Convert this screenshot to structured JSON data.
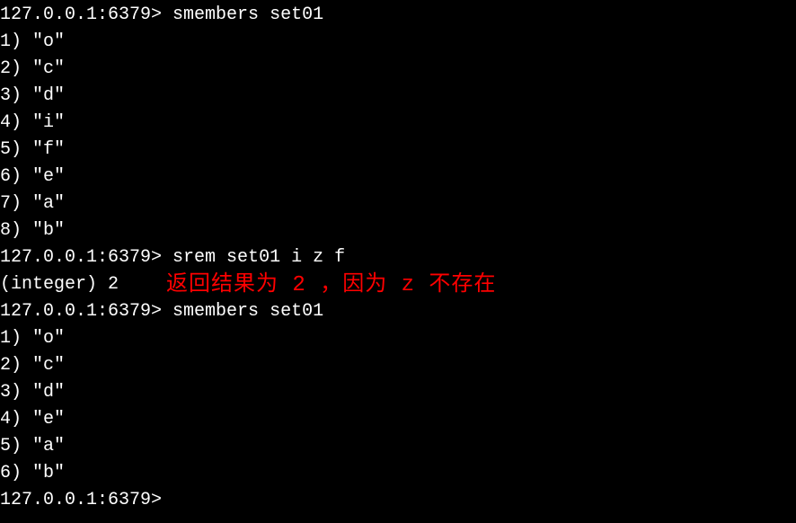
{
  "prompt": "127.0.0.1:6379>",
  "commands": {
    "cmd1": "smembers set01",
    "cmd2": "srem set01 i z f",
    "cmd3": "smembers set01"
  },
  "results1": {
    "r1": "1) \"o\"",
    "r2": "2) \"c\"",
    "r3": "3) \"d\"",
    "r4": "4) \"i\"",
    "r5": "5) \"f\"",
    "r6": "6) \"e\"",
    "r7": "7) \"a\"",
    "r8": "8) \"b\""
  },
  "integer_result": "(integer) 2",
  "annotation": "返回结果为 2 ，因为 z 不存在",
  "results2": {
    "r1": "1) \"o\"",
    "r2": "2) \"c\"",
    "r3": "3) \"d\"",
    "r4": "4) \"e\"",
    "r5": "5) \"a\"",
    "r6": "6) \"b\""
  }
}
